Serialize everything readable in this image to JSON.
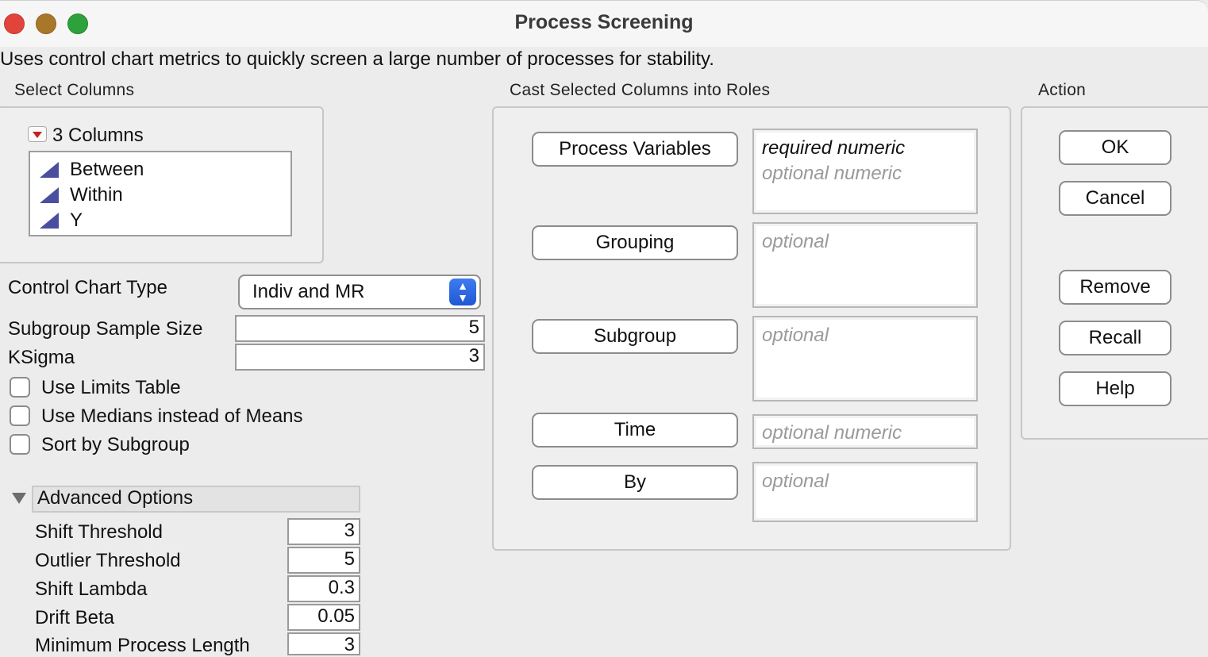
{
  "window": {
    "title": "Process Screening"
  },
  "description": "Uses control chart metrics to quickly screen a large number of processes for stability.",
  "select_columns": {
    "label": "Select Columns",
    "count_label": "3 Columns",
    "columns": [
      "Between",
      "Within",
      "Y"
    ]
  },
  "settings": {
    "control_chart_type_label": "Control Chart Type",
    "control_chart_type_value": "Indiv and MR",
    "subgroup_size_label": "Subgroup Sample Size",
    "subgroup_size_value": "5",
    "ksigma_label": "KSigma",
    "ksigma_value": "3",
    "checkboxes": [
      "Use Limits Table",
      "Use Medians instead of Means",
      "Sort by Subgroup"
    ]
  },
  "advanced": {
    "header": "Advanced Options",
    "fields": [
      {
        "label": "Shift Threshold",
        "value": "3"
      },
      {
        "label": "Outlier Threshold",
        "value": "5"
      },
      {
        "label": "Shift Lambda",
        "value": "0.3"
      },
      {
        "label": "Drift Beta",
        "value": "0.05"
      },
      {
        "label": "Minimum Process Length",
        "value": "3"
      }
    ]
  },
  "roles": {
    "label": "Cast Selected Columns into Roles",
    "process_variables": {
      "button": "Process Variables",
      "hint_required": "required numeric",
      "hint_optional": "optional numeric"
    },
    "grouping": {
      "button": "Grouping",
      "hint": "optional"
    },
    "subgroup": {
      "button": "Subgroup",
      "hint": "optional"
    },
    "time": {
      "button": "Time",
      "hint": "optional numeric"
    },
    "by": {
      "button": "By",
      "hint": "optional"
    }
  },
  "action": {
    "label": "Action",
    "ok": "OK",
    "cancel": "Cancel",
    "remove": "Remove",
    "recall": "Recall",
    "help": "Help"
  },
  "colors": {
    "accent": "#2a64e0",
    "close": "#e0443a",
    "minimize": "#a9772a",
    "maximize": "#2da13c"
  },
  "icons": {
    "continuous_column": "continuous-column-icon",
    "disclosure": "red-disclosure-icon"
  }
}
